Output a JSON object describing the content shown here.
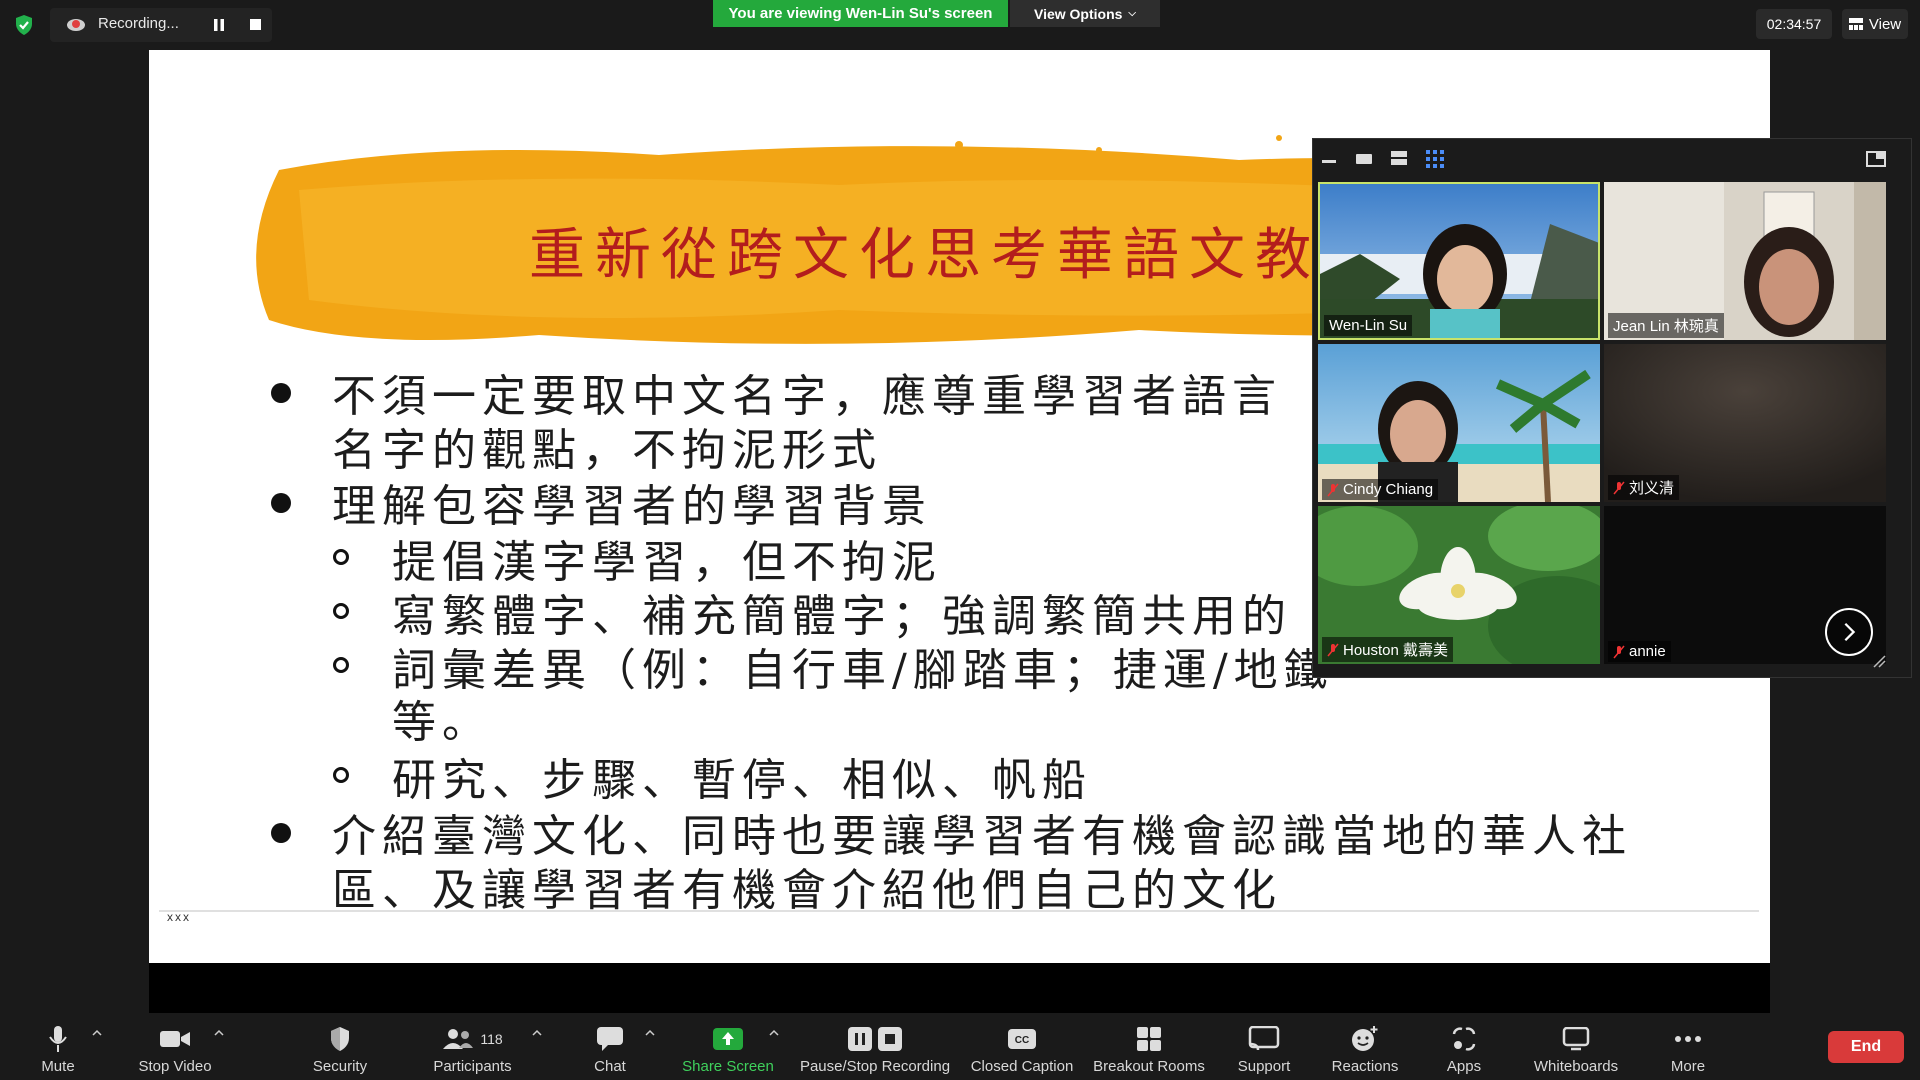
{
  "top_bar": {
    "recording_label": "Recording...",
    "viewing_banner": "You are viewing Wen-Lin Su's screen",
    "view_options_label": "View Options",
    "timer": "02:34:57",
    "view_label": "View"
  },
  "slide": {
    "title": "重新從跨文化思考華語文教",
    "lines": [
      "不須一定要取中文名字，應尊重學習者語言",
      "名字的觀點，不拘泥形式",
      "理解包容學習者的學習背景",
      "提倡漢字學習，但不拘泥",
      "寫繁體字、補充簡體字；強調繁簡共用的",
      "詞彙差異（例：自行車/腳踏車；捷運/地鐵",
      "等。",
      "研究、步驟、暫停、相似、帆船",
      "介紹臺灣文化、同時也要讓學習者有機會認識當地的華人社",
      "區、及讓學習者有機會介紹他們自己的文化"
    ],
    "footer": "xxx"
  },
  "gallery": {
    "participants": [
      {
        "name": "Wen-Lin Su",
        "muted": false,
        "active": true
      },
      {
        "name": "Jean Lin 林琬真",
        "muted": false,
        "active": false
      },
      {
        "name": "Cindy Chiang",
        "muted": true,
        "active": false
      },
      {
        "name": "刘义清",
        "muted": true,
        "active": false
      },
      {
        "name": "Houston 戴壽美",
        "muted": true,
        "active": false
      },
      {
        "name": "annie",
        "muted": true,
        "active": false
      }
    ]
  },
  "toolbar": {
    "mute": "Mute",
    "stop_video": "Stop Video",
    "security": "Security",
    "participants": "Participants",
    "participants_count": "118",
    "chat": "Chat",
    "share_screen": "Share Screen",
    "pause_stop_recording": "Pause/Stop Recording",
    "closed_caption": "Closed Caption",
    "breakout_rooms": "Breakout Rooms",
    "support": "Support",
    "reactions": "Reactions",
    "apps": "Apps",
    "whiteboards": "Whiteboards",
    "more": "More",
    "end": "End"
  },
  "colors": {
    "share_green": "#24a93c",
    "end_red": "#d93a3a",
    "title_red": "#b31d1d",
    "brush_orange": "#f2a515",
    "active_speaker": "#c8e36a"
  },
  "icons": [
    "shield-icon",
    "recording-icon",
    "pause-icon",
    "stop-icon",
    "grid-icon",
    "microphone-icon",
    "video-icon",
    "participants-icon",
    "chat-icon",
    "share-screen-icon",
    "cc-icon",
    "breakout-icon",
    "support-icon",
    "reactions-icon",
    "apps-icon",
    "whiteboard-icon",
    "more-icon",
    "chevron-right-icon"
  ]
}
